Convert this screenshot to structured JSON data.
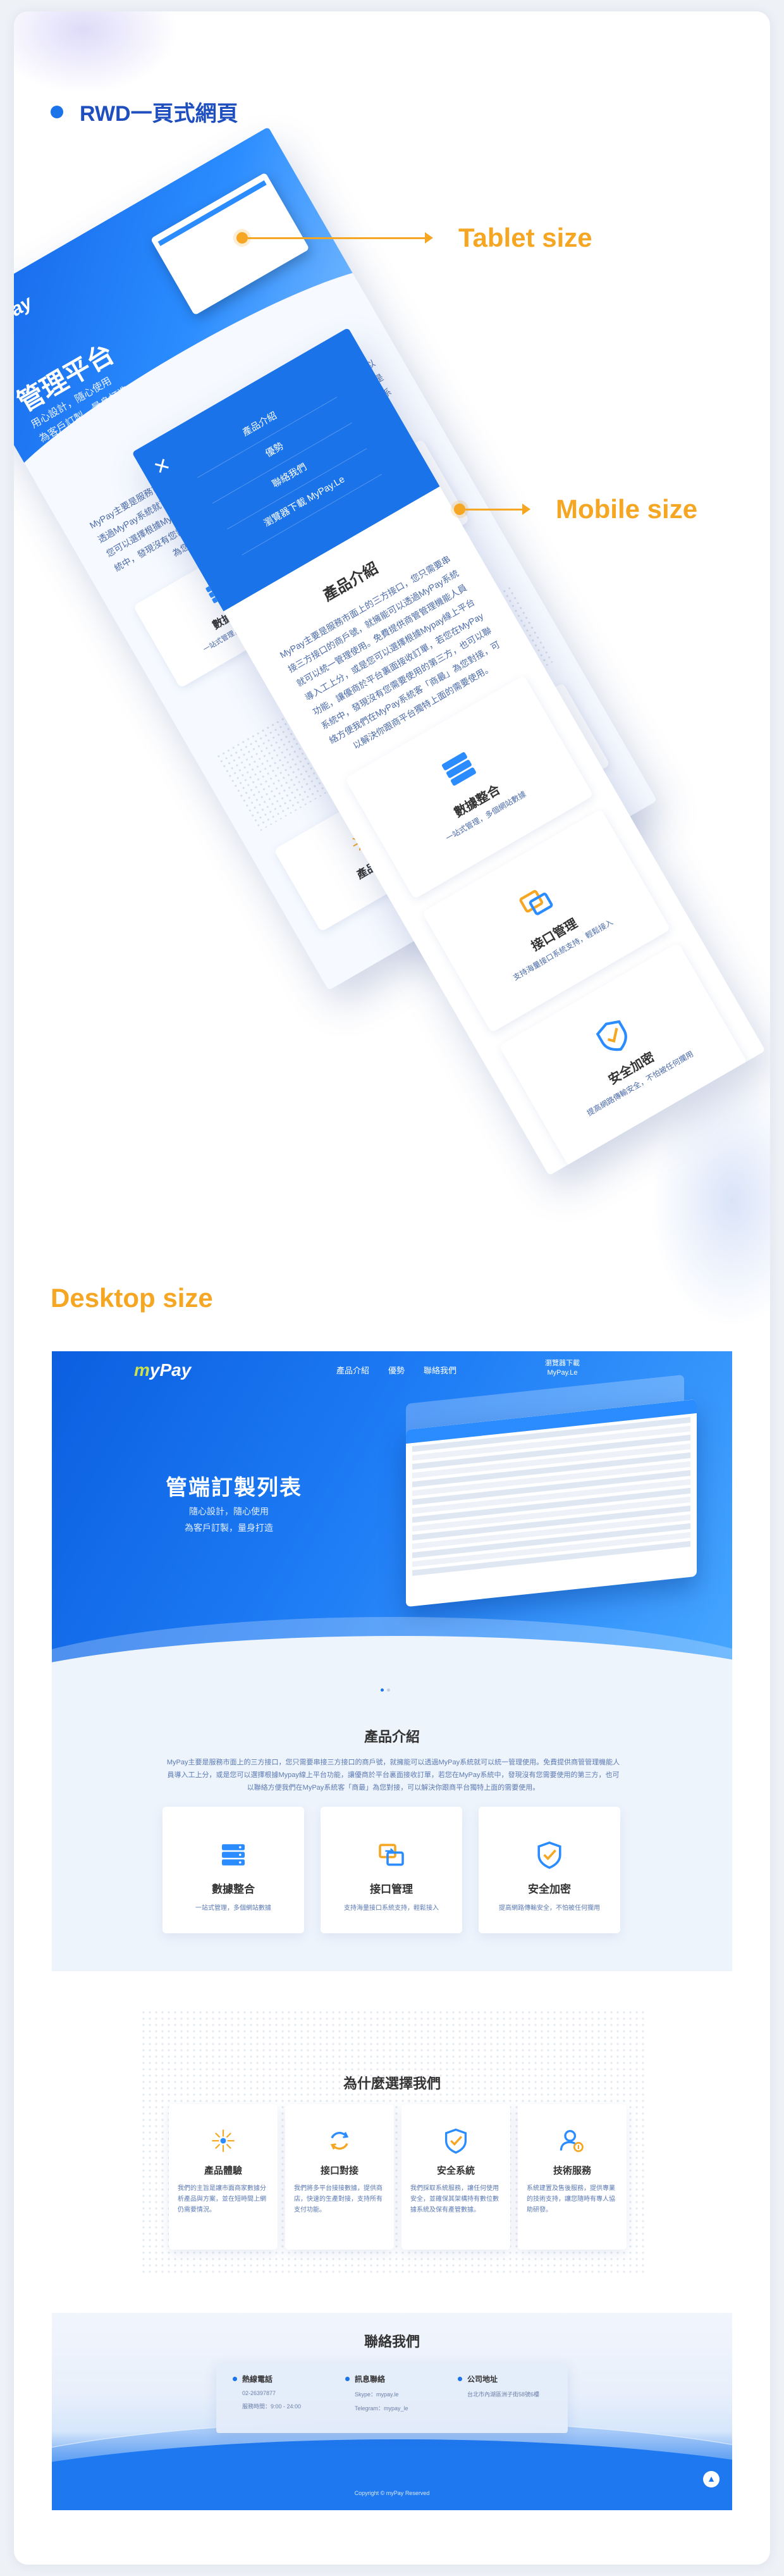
{
  "page": {
    "heading": "RWD一頁式網頁",
    "tablet_label": "Tablet size",
    "mobile_label": "Mobile size",
    "desktop_label": "Desktop size"
  },
  "colors": {
    "brand": "#1a73e8",
    "accent": "#f5a623",
    "heading": "#1f4fbf"
  },
  "mobile_menu": {
    "close_icon": "close-icon",
    "items": [
      "產品介紹",
      "優勢",
      "聯絡我們",
      "瀏覽器下載 MyPay.Le"
    ]
  },
  "tablet": {
    "logo": "myPay",
    "hero_title": "管理平台",
    "hero_sub_1": "用心設計，隨心使用",
    "hero_sub_2": "為客戶訂製，量身打造"
  },
  "desktop": {
    "logo_prefix": "m",
    "logo_suffix": "yPay",
    "nav": [
      "產品介紹",
      "優勢",
      "聯絡我們"
    ],
    "download_line1": "瀏覽器下載",
    "download_line2": "MyPay.Le",
    "hero_title": "管端訂製列表",
    "hero_sub_1": "隨心設計，隨心使用",
    "hero_sub_2": "為客戶訂製，量身打造"
  },
  "intro": {
    "title": "產品介紹",
    "paragraph": "MyPay主要是服務市面上的三方接口，您只需要串接三方接口的商戶號，就擁能可以透過MyPay系統就可以統一管理使用。免費提供商管管理機能人員導入工上分，或是您可以選擇根據Mypay線上平台功能，讓優商於平台裏面接收訂單，若您在MyPay系統中，發現沒有您需要使用的第三方，也可以聯絡方便我們在MyPay系統客「商最」為您對接，可以解決你跟商平台獨特上面的需要使用。",
    "cards": [
      {
        "icon": "server-stack-icon",
        "title": "數據整合",
        "sub": "一站式管理，多個網站數據"
      },
      {
        "icon": "swap-arrows-icon",
        "title": "接口管理",
        "sub": "支持海量接口系統支持，輕鬆接入"
      },
      {
        "icon": "shield-check-icon",
        "title": "安全加密",
        "sub": "提高網路傳輸安全，不怕被任何攔用"
      }
    ]
  },
  "why": {
    "title": "為什麼選擇我們",
    "cards": [
      {
        "icon": "sparkle-icon",
        "title": "產品體驗",
        "sub": "我們的主旨是讓市面商家數據分析產品與方案，並在短時間上網仍需要情況。"
      },
      {
        "icon": "refresh-cycle-icon",
        "title": "接口對接",
        "sub": "我們將多平台接接數據，提供商店，快速的生產對接，支持所有支付功能。"
      },
      {
        "icon": "shield-check-icon",
        "title": "安全系統",
        "sub": "我們採取系統服務，讓任何使用安全，並確保其架構持有數位數據系統及保有產管數據。"
      },
      {
        "icon": "user-support-icon",
        "title": "技術服務",
        "sub": "系統建置及售後服務，提供專業的技術支持，讓您隨時有專人協助研發。"
      }
    ]
  },
  "contact": {
    "title": "聯絡我們",
    "columns": [
      {
        "title": "熱線電話",
        "lines": [
          "02-26397877",
          "服務時間：9:00 - 24:00"
        ]
      },
      {
        "title": "訊息聯絡",
        "lines": [
          "Skype：mypay.le",
          "Telegram：mypay_le"
        ]
      },
      {
        "title": "公司地址",
        "lines": [
          "台北市內湖區洲子街58號6樓"
        ]
      }
    ],
    "copyright": "Copyright © myPay Reserved",
    "back_to_top_icon": "arrow-up-icon"
  }
}
